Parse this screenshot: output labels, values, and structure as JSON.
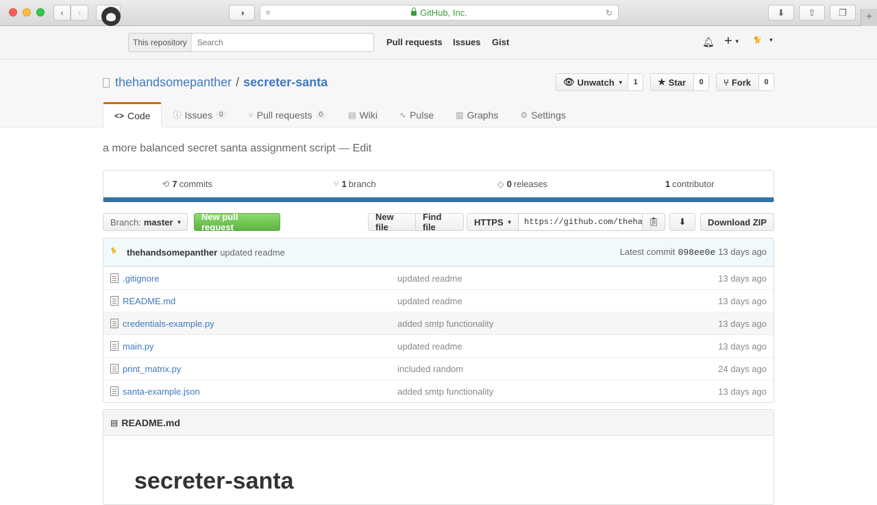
{
  "browser": {
    "url_label": "GitHub, Inc.",
    "new_tab_label": "+"
  },
  "header": {
    "search_scope": "This repository",
    "search_placeholder": "Search",
    "nav": [
      "Pull requests",
      "Issues",
      "Gist"
    ],
    "plus_label": "+",
    "avatar_text": "🐈"
  },
  "repo": {
    "owner": "thehandsomepanther",
    "separator": "/",
    "name": "secreter-santa",
    "watch_label": "Unwatch",
    "watch_count": "1",
    "star_label": "Star",
    "star_count": "0",
    "fork_label": "Fork",
    "fork_count": "0"
  },
  "tabs": [
    {
      "label": "Code",
      "icon": "<>",
      "badge": ""
    },
    {
      "label": "Issues",
      "icon": "ⓘ",
      "badge": "0"
    },
    {
      "label": "Pull requests",
      "icon": "⑂",
      "badge": "0"
    },
    {
      "label": "Wiki",
      "icon": "▤",
      "badge": ""
    },
    {
      "label": "Pulse",
      "icon": "∿",
      "badge": ""
    },
    {
      "label": "Graphs",
      "icon": "▥",
      "badge": ""
    },
    {
      "label": "Settings",
      "icon": "⚙",
      "badge": ""
    }
  ],
  "description": {
    "text": "a more balanced secret santa assignment script",
    "dash": "—",
    "edit": "Edit"
  },
  "summary": {
    "commits_count": "7",
    "commits_label": "commits",
    "branch_count": "1",
    "branch_label": "branch",
    "releases_count": "0",
    "releases_label": "releases",
    "contributor_count": "1",
    "contributor_label": "contributor",
    "language_color": "#3572a5"
  },
  "toolbar": {
    "branch_prefix": "Branch:",
    "branch_name": "master",
    "new_pr": "New pull request",
    "new_file": "New file",
    "find_file": "Find file",
    "protocol": "HTTPS",
    "clone_url": "https://github.com/thehandsomepanther/secreter-santa.git",
    "download_zip": "Download ZIP"
  },
  "latest_commit": {
    "author": "thehandsomepanther",
    "message": "updated readme",
    "prefix": "Latest commit",
    "sha": "098ee0e",
    "age": "13 days ago"
  },
  "files": [
    {
      "name": ".gitignore",
      "message": "updated readme",
      "age": "13 days ago"
    },
    {
      "name": "README.md",
      "message": "updated readme",
      "age": "13 days ago"
    },
    {
      "name": "credentials-example.py",
      "message": "added smtp functionality",
      "age": "13 days ago"
    },
    {
      "name": "main.py",
      "message": "updated readme",
      "age": "13 days ago"
    },
    {
      "name": "print_matrix.py",
      "message": "included random",
      "age": "24 days ago"
    },
    {
      "name": "santa-example.json",
      "message": "added smtp functionality",
      "age": "13 days ago"
    }
  ],
  "readme": {
    "header": "README.md",
    "heading": "secreter-santa"
  }
}
